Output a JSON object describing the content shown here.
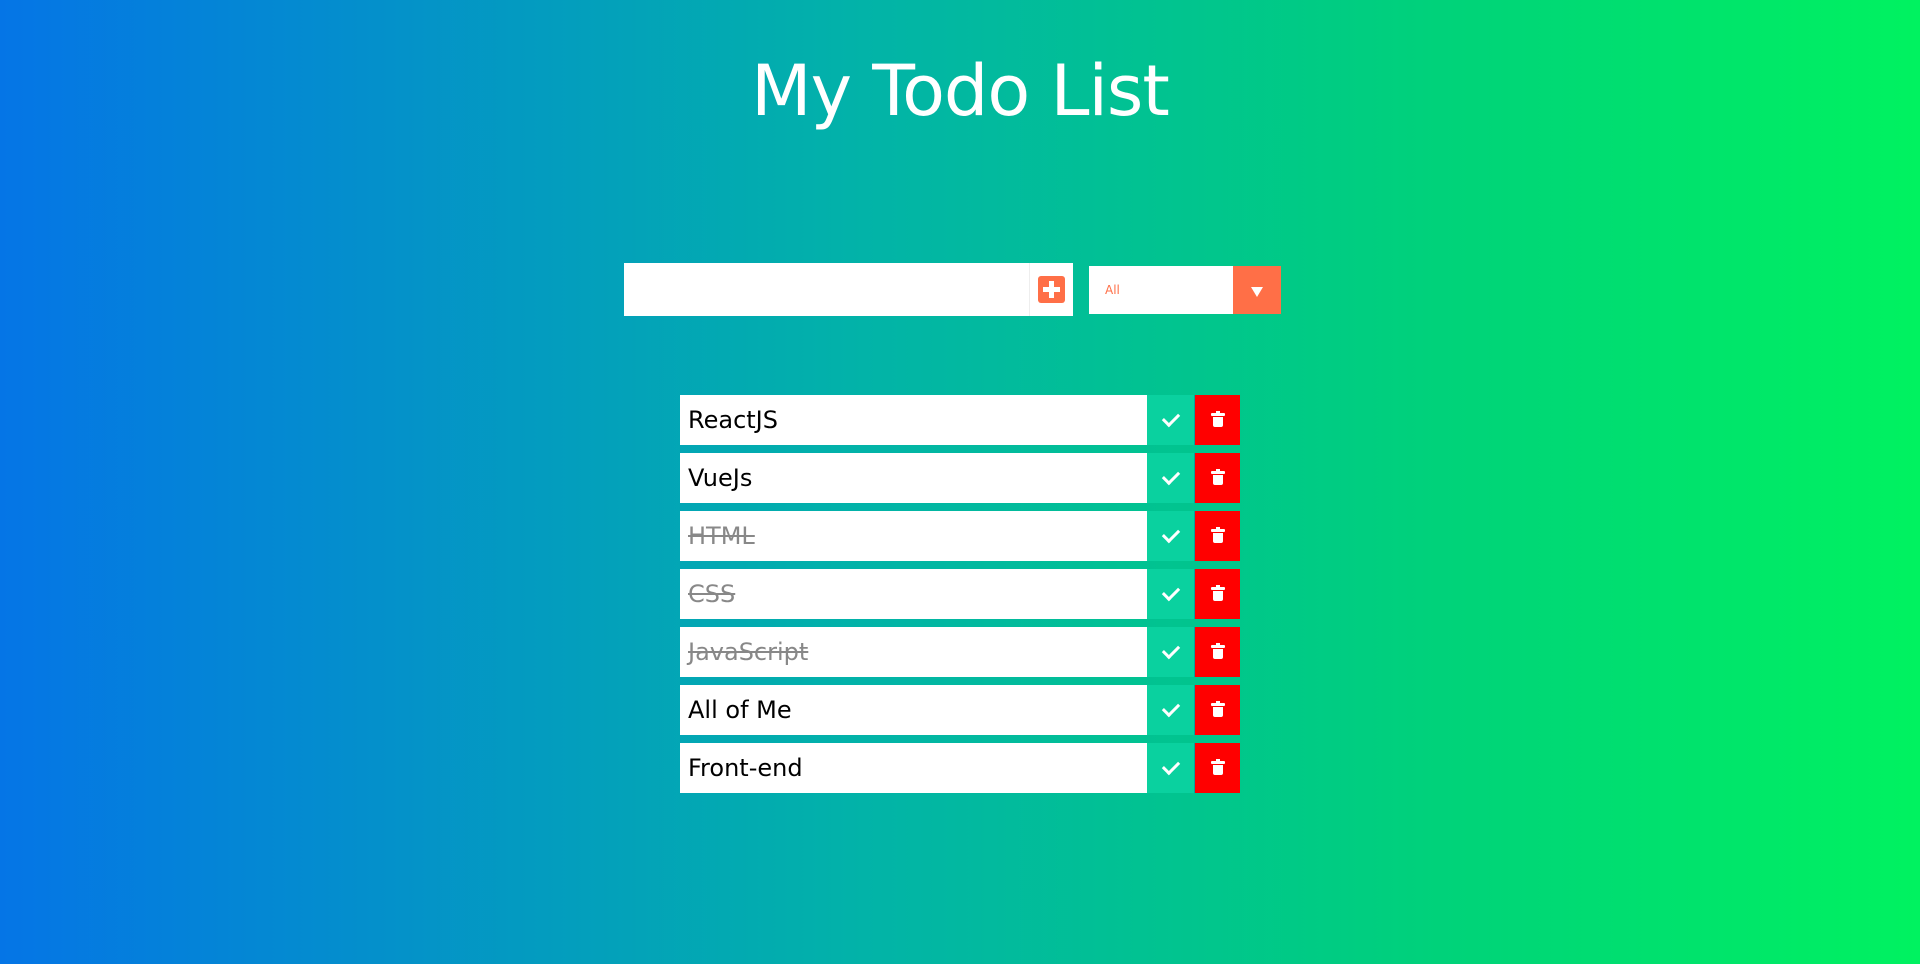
{
  "header": {
    "title": "My Todo List"
  },
  "add_form": {
    "input_value": "",
    "input_placeholder": "",
    "add_icon": "plus-square-icon"
  },
  "filter": {
    "selected": "All",
    "arrow_icon": "caret-down-icon"
  },
  "todos": [
    {
      "text": "ReactJS",
      "completed": false
    },
    {
      "text": "VueJs",
      "completed": false
    },
    {
      "text": "HTML",
      "completed": true
    },
    {
      "text": "CSS",
      "completed": true
    },
    {
      "text": "JavaScript",
      "completed": true
    },
    {
      "text": "All of Me",
      "completed": false
    },
    {
      "text": "Front-end",
      "completed": false
    }
  ],
  "colors": {
    "gradient_start": "#0575e6",
    "gradient_end": "#00f260",
    "accent": "#ff6f47",
    "complete_button": "#0ad19f",
    "delete_button": "#ff0000"
  }
}
